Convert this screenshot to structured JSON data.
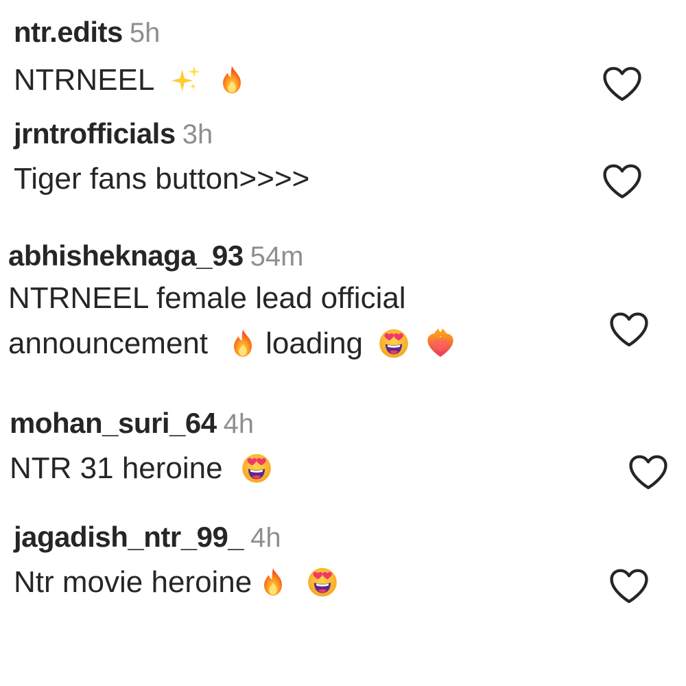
{
  "comments": [
    {
      "username": "ntr.edits",
      "time": "5h",
      "text": "NTRNEEL",
      "emojis": [
        "sparkles-emoji",
        "fire-emoji"
      ]
    },
    {
      "username": "jrntrofficials",
      "time": "3h",
      "text": "Tiger fans button>>>>",
      "emojis": []
    },
    {
      "username": "abhisheknaga_93",
      "time": "54m",
      "text_line1": "NTRNEEL female lead official",
      "text_line2a": "announcement",
      "text_line2b": "loading",
      "emojis": [
        "fire-emoji",
        "heart-eyes-emoji",
        "heart-on-fire-emoji"
      ]
    },
    {
      "username": "mohan_suri_64",
      "time": "4h",
      "text": "NTR 31 heroine",
      "emojis": [
        "heart-eyes-emoji"
      ]
    },
    {
      "username": "jagadish_ntr_99_",
      "time": "4h",
      "text": "Ntr movie heroine",
      "emojis": [
        "fire-emoji",
        "heart-eyes-emoji"
      ]
    }
  ],
  "like_icon": "heart-outline-icon",
  "colors": {
    "username": "#262626",
    "timestamp": "#8e8e8e",
    "heart_outline": "#262626"
  }
}
